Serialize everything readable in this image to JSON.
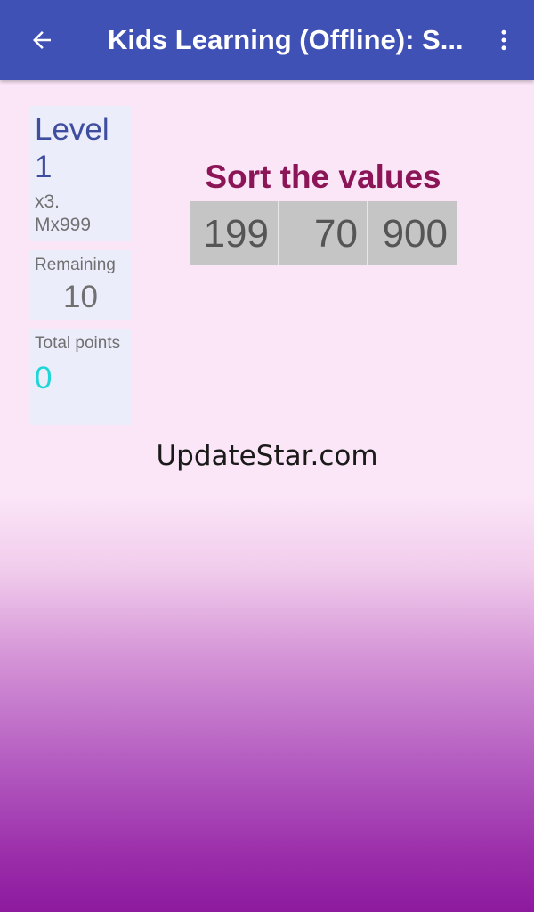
{
  "appbar": {
    "title": "Kids Learning (Offline): S...",
    "back_icon": "arrow-back-icon",
    "menu_icon": "more-vert-icon",
    "color": "#3f51b5"
  },
  "stats": {
    "level_label": "Level",
    "level_value": "1",
    "multiplier": "x3.",
    "max_label": "Mx999",
    "remaining_label": "Remaining",
    "remaining_value": "10",
    "points_label": "Total points",
    "points_value": "0"
  },
  "exercise": {
    "question": "Sort the values",
    "values": [
      "199",
      "70",
      "900"
    ]
  },
  "watermark": "UpdateStar.com",
  "colors": {
    "question": "#8b1556",
    "points": "#1fd6d6",
    "panel": "#ecedfb"
  }
}
